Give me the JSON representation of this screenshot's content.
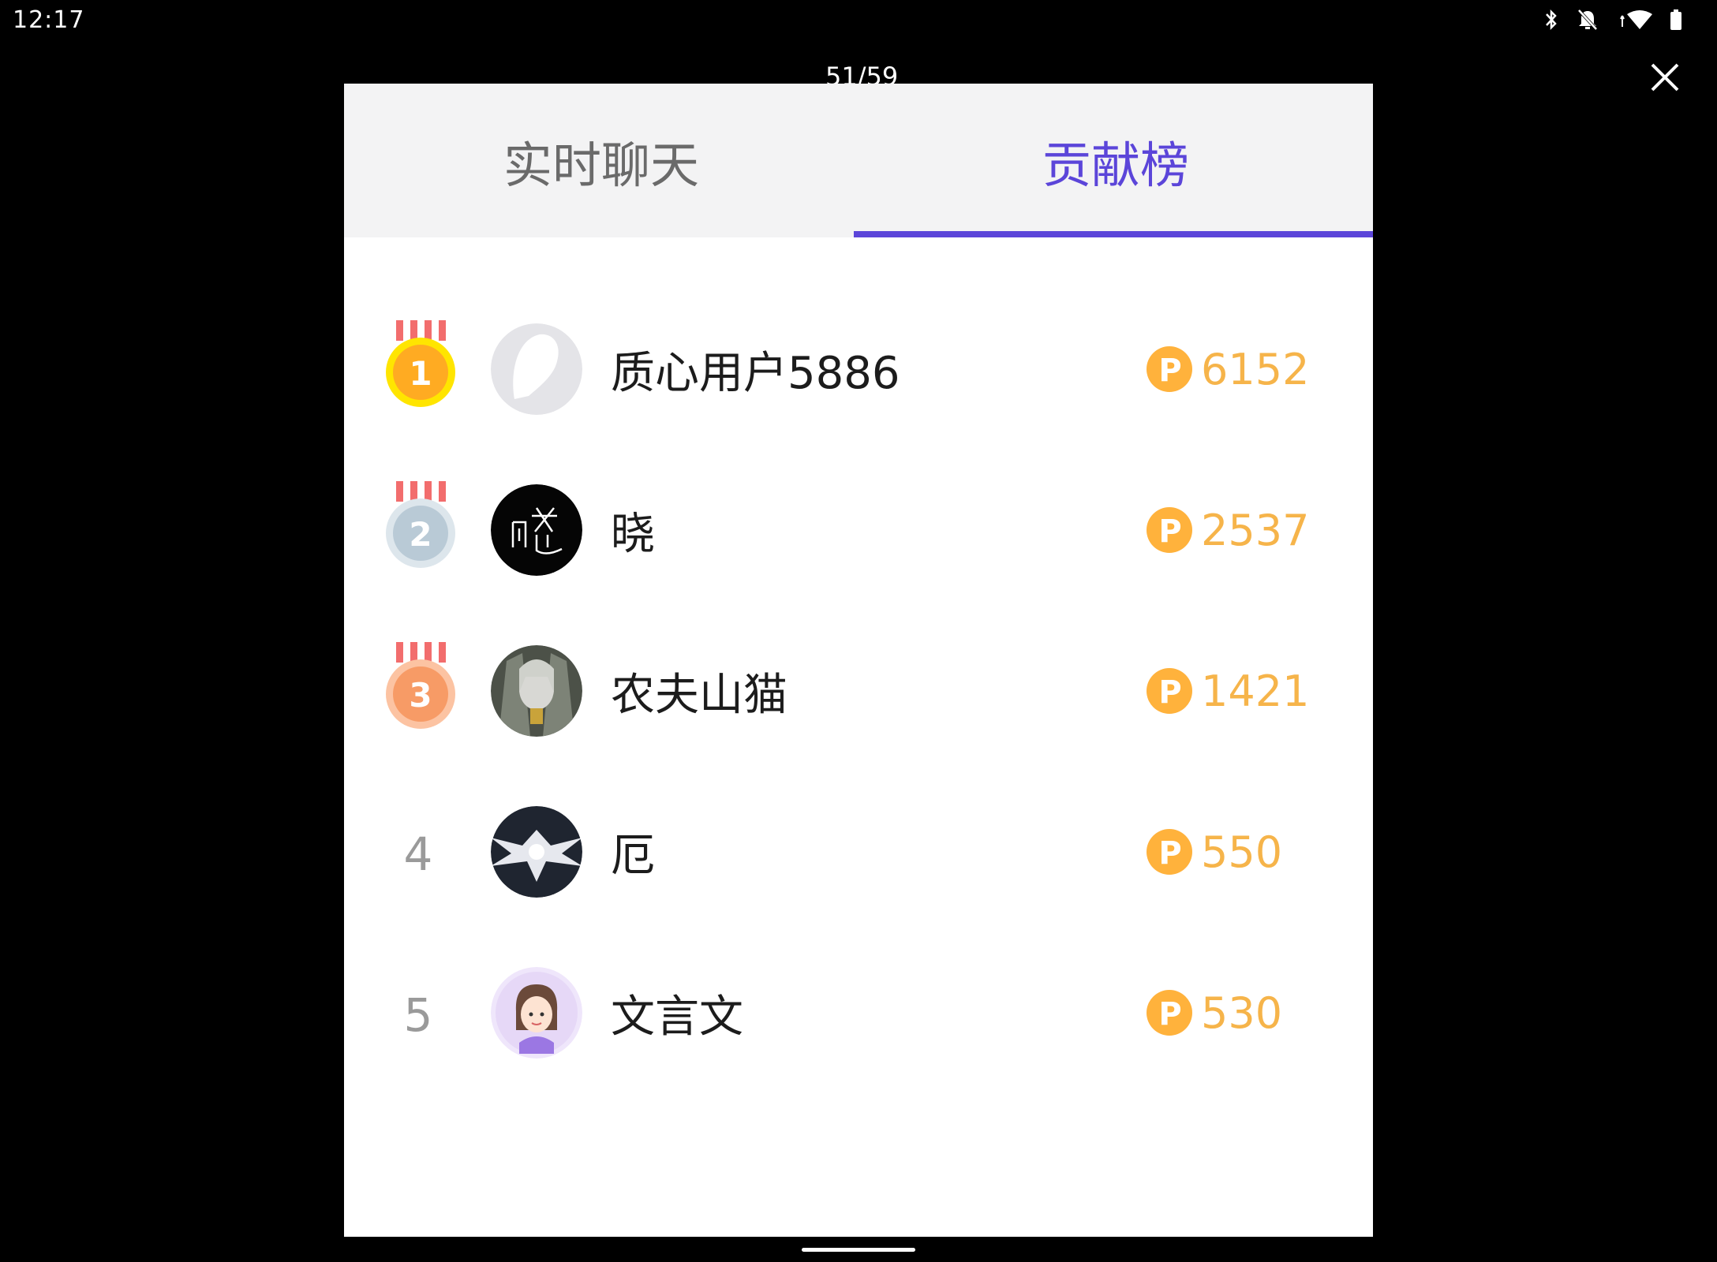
{
  "status_bar": {
    "time": "12:17"
  },
  "viewer": {
    "page_counter": "51/59"
  },
  "tabs": [
    {
      "label": "实时聊天",
      "active": false
    },
    {
      "label": "贡献榜",
      "active": true
    }
  ],
  "colors": {
    "accent": "#5b45d9",
    "score": "#f6b44a",
    "gold": "#ffb21f",
    "silver": "#b9cad6",
    "bronze": "#f79b66"
  },
  "leaderboard": [
    {
      "rank": "1",
      "name": "质心用户5886",
      "score": "6152",
      "medal": "gold"
    },
    {
      "rank": "2",
      "name": "晓",
      "score": "2537",
      "medal": "silver"
    },
    {
      "rank": "3",
      "name": "农夫山猫",
      "score": "1421",
      "medal": "bronze"
    },
    {
      "rank": "4",
      "name": "厄",
      "score": "550"
    },
    {
      "rank": "5",
      "name": "文言文",
      "score": "530"
    }
  ]
}
